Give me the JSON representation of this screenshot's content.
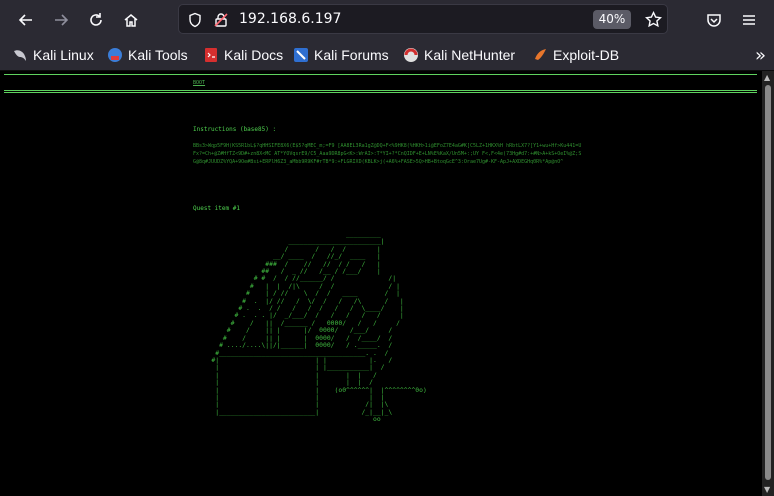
{
  "browser": {
    "url": "192.168.6.197",
    "zoom": "40%",
    "icons": {
      "back": "back-arrow-icon",
      "forward": "forward-arrow-icon",
      "reload": "reload-icon",
      "home": "home-icon",
      "shield": "shield-icon",
      "lock": "insecure-lock-icon",
      "star": "bookmark-star-icon",
      "pocket": "pocket-icon",
      "menu": "hamburger-menu-icon"
    }
  },
  "bookmarks": [
    {
      "label": "Kali Linux",
      "icon": "kali-dragon-icon"
    },
    {
      "label": "Kali Tools",
      "icon": "kali-tools-icon"
    },
    {
      "label": "Kali Docs",
      "icon": "kali-docs-icon"
    },
    {
      "label": "Kali Forums",
      "icon": "kali-forums-icon"
    },
    {
      "label": "Kali NetHunter",
      "icon": "nethunter-icon"
    },
    {
      "label": "Exploit-DB",
      "icon": "exploit-db-icon"
    }
  ],
  "page": {
    "link_text": "BOOT",
    "instructions_title": "Instructions (base85) :",
    "base85_text": "BBs3>Wqp5F9H(KS5R1bL$?qHHSIFE8X6(E$5?qMEC_m;=F9 [AA8EL3Ra1gZ@DQ+F<%9HK8(%HKH>1i@EFoZ7E4aG#K[C5LZ+1HKX%H hRbtLX7?[Y1+wu+Hf>Ku441=UFx?=Ch+@Z#HfTZ<9D#+zn8X<MC AT*YOVqsrE9/C5_Aaa9DR8pG<K>:WrAI>:T*YI+?*CnQIDF+E+LN%E%KaX/Un5M+:;UY F<,F<4e(73Hg#d7:+#N>A+kS+OeI%@Z;SG@8q#JUUDZ%YQA+9Oe#Bsi+ERPlH6Z3_aMbb9R9KF#rTB*9:+FLGRIXD(KBLK>j(+A6%+FASE>5Q>HB+BtoqGcE^3:Orae7Ug#-KF-ApJ+AXDEGHq0R%*Ap@nO^",
    "quest_title": "Quest item #1",
    "ascii_art": [
      "                                       _________",
      "                        ________________________|",
      "                       /       /   /  /        |",
      "                    __/ ____  /   //_/  ____   |",
      "                  ###  /    //   //  / /   /   |",
      "                 ##   /  _ //   /__ / /___/    |",
      "               # #  /  / //______/ /              /|",
      "              #   |  |  /|\\     /  /              / |",
      "             #    | / //    \\  /  /   ____       /  |",
      "            #  .  |/ //   /  \\/  /   /   /\\      /   |",
      "           # .  .  / /   /   /  /   /   /  \\____/    |",
      "          # .  . . |/  _/___/  /   /   /   /   /     |",
      "         #    /   ||  /______ /   0000/   /   /     /",
      "        #    /    || |      |/  0000/   /___/     /",
      "       #    /     || |      |  0000/   /  /____/  /",
      "      # ..../....\\||/|______|  0000/   / ._____.  /",
      "     #______________________________________. .  /",
      "    #|                         | |           |.   /",
      "     |                         | |___________|  /",
      "     |                         |       |  |   /",
      "     |                         |       |  |  /",
      "     |                         |    (o0^^^^^^|  |^^^^^^^^0o)",
      "     |                         |             |  |",
      "     |                         |            /|  |\\",
      "     |_________________________|           /_|__|_\\",
      "                                              oo"
    ]
  }
}
